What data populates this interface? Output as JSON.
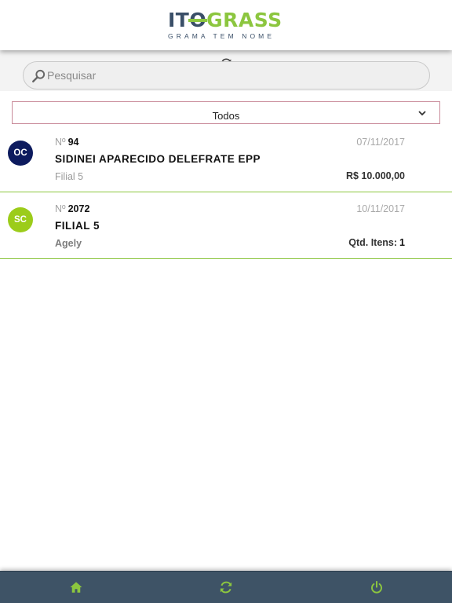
{
  "header": {
    "logo": {
      "word_part1": "IT",
      "word_part2": "O",
      "word_part3": "GRASS",
      "tagline": "GRAMA TEM NOME"
    }
  },
  "toolbar": {
    "refresh_icon": "refresh-icon"
  },
  "search": {
    "placeholder": "Pesquisar",
    "value": "",
    "icon": "search-icon"
  },
  "filter": {
    "selected": "Todos",
    "icon": "chevron-down-icon"
  },
  "items": [
    {
      "avatar": "OC",
      "avatar_color": "#0d1b5e",
      "number_prefix": "Nº",
      "number": "94",
      "date": "07/11/2017",
      "title": "SIDINEI APARECIDO DELEFRATE EPP",
      "subtitle": "Filial 5",
      "right_value": "R$ 10.000,00"
    },
    {
      "avatar": "SC",
      "avatar_color": "#9ccc1a",
      "number_prefix": "Nº",
      "number": "2072",
      "date": "10/11/2017",
      "title": "FILIAL 5",
      "subtitle": "Agely",
      "right_label": "Qtd. Itens:",
      "right_qty": "1"
    }
  ],
  "bottom_nav": {
    "items": [
      {
        "icon": "home-icon"
      },
      {
        "icon": "sync-icon"
      },
      {
        "icon": "power-icon"
      }
    ],
    "icon_color": "#8cc63f",
    "background": "#3e5366"
  },
  "colors": {
    "accent": "#8cc63f",
    "brand_dark": "#3a4f68"
  }
}
